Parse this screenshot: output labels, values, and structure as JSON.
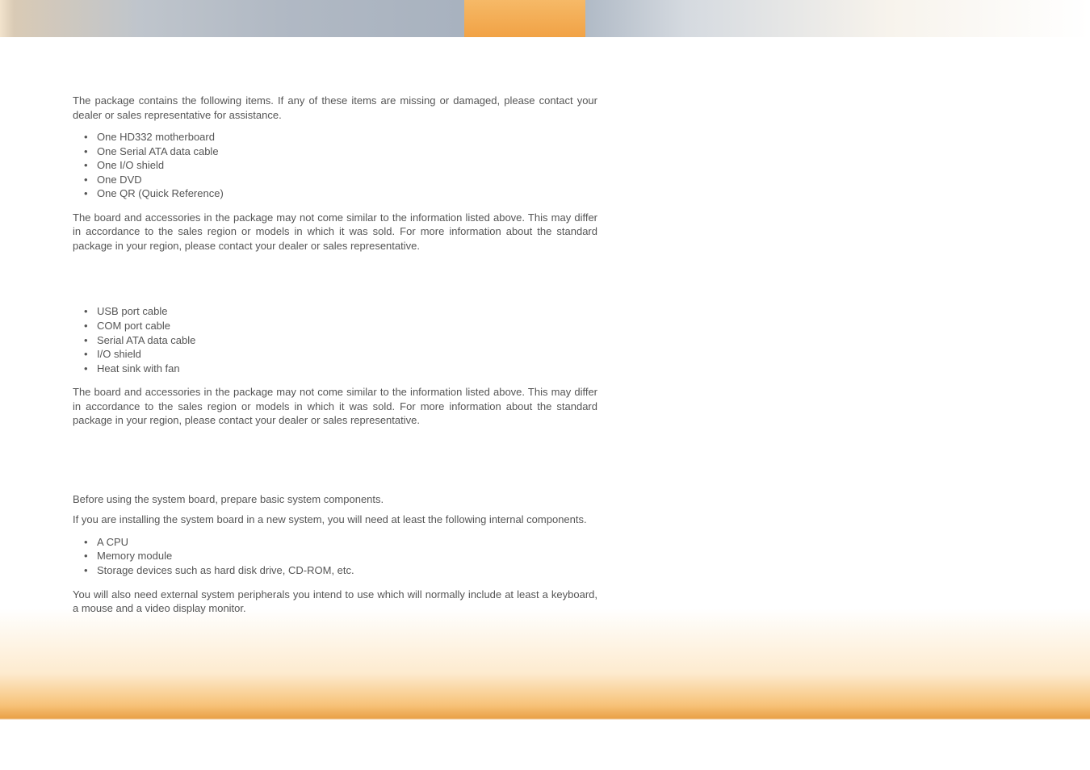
{
  "section1": {
    "intro": "The package contains the following items. If any of these items are missing or damaged, please contact your dealer or sales representative for assistance.",
    "items": [
      "One HD332 motherboard",
      "One Serial ATA data cable",
      "One I/O shield",
      "One DVD",
      "One QR (Quick Reference)"
    ],
    "outro": "The board and accessories in the package may not come similar to the information listed above. This may differ in accordance to the sales region or models in which it was sold. For more information about the standard package in your region, please contact your dealer or sales representative."
  },
  "section2": {
    "items": [
      "USB port cable",
      "COM port cable",
      "Serial ATA data cable",
      "I/O shield",
      "Heat sink with fan"
    ],
    "outro": "The board and accessories in the package may not come similar to the information listed above. This may differ in accordance to the sales region or models in which it was sold. For more information about the standard package in your region, please contact your dealer or sales representative."
  },
  "section3": {
    "p1": "Before using the system board, prepare basic system components.",
    "p2": "If you are installing the system board in a new system, you will need at least the following internal components.",
    "items": [
      "A CPU",
      "Memory module",
      "Storage devices such as hard disk drive, CD-ROM, etc."
    ],
    "p3": "You will also need external system peripherals you intend to use which will normally include at least a keyboard, a mouse and a video display monitor."
  }
}
